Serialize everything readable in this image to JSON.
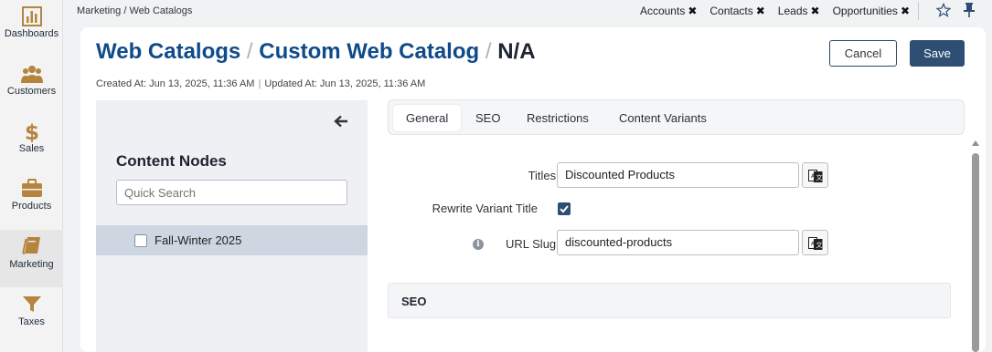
{
  "nav": {
    "items": [
      {
        "label": "Dashboards",
        "icon": "bar-chart-icon"
      },
      {
        "label": "Customers",
        "icon": "users-icon"
      },
      {
        "label": "Sales",
        "icon": "dollar-icon"
      },
      {
        "label": "Products",
        "icon": "briefcase-icon"
      },
      {
        "label": "Marketing",
        "icon": "book-icon"
      },
      {
        "label": "Taxes",
        "icon": "funnel-icon"
      }
    ],
    "icon_color": "#b5843f",
    "active": "Marketing"
  },
  "topbar": {
    "breadcrumb": "Marketing / Web Catalogs",
    "pinned_tabs": [
      "Accounts",
      "Contacts",
      "Leads",
      "Opportunities"
    ],
    "close_glyph": "✖"
  },
  "header": {
    "title_parts": [
      "Web Catalogs",
      "/",
      "Custom Web Catalog",
      "/",
      "N/A"
    ],
    "created": "Created At: Jun 13, 2025, 11:36 AM",
    "divider": "|",
    "updated": "Updated At: Jun 13, 2025, 11:36 AM",
    "cancel_label": "Cancel",
    "save_label": "Save",
    "accent": "#0f4a8a"
  },
  "tree": {
    "title": "Content Nodes",
    "search_placeholder": "Quick Search",
    "nodes": [
      {
        "label": "Fall-Winter 2025",
        "checked": false
      }
    ]
  },
  "tabs": [
    "General",
    "SEO",
    "Restrictions",
    "Content Variants"
  ],
  "active_tab": "General",
  "form": {
    "titles_label": "Titles",
    "titles_value": "Discounted Products",
    "rewrite_label": "Rewrite Variant Title",
    "rewrite_checked": true,
    "slug_label": "URL Slug",
    "slug_value": "discounted-products",
    "required_mark": "*",
    "info_glyph": "i"
  },
  "section": {
    "label": "SEO"
  }
}
